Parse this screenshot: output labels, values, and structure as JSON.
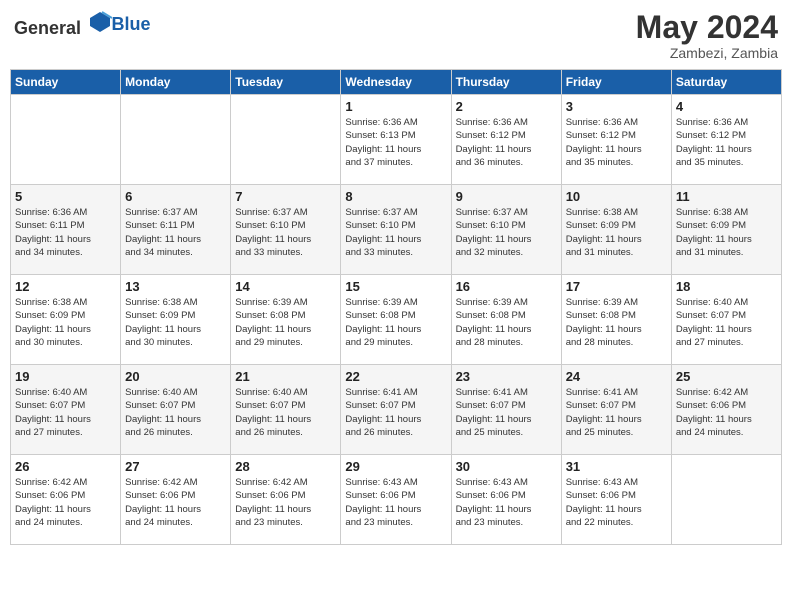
{
  "header": {
    "logo_general": "General",
    "logo_blue": "Blue",
    "month_year": "May 2024",
    "location": "Zambezi, Zambia"
  },
  "calendar": {
    "days_of_week": [
      "Sunday",
      "Monday",
      "Tuesday",
      "Wednesday",
      "Thursday",
      "Friday",
      "Saturday"
    ],
    "weeks": [
      [
        {
          "day": "",
          "info": ""
        },
        {
          "day": "",
          "info": ""
        },
        {
          "day": "",
          "info": ""
        },
        {
          "day": "1",
          "info": "Sunrise: 6:36 AM\nSunset: 6:13 PM\nDaylight: 11 hours\nand 37 minutes."
        },
        {
          "day": "2",
          "info": "Sunrise: 6:36 AM\nSunset: 6:12 PM\nDaylight: 11 hours\nand 36 minutes."
        },
        {
          "day": "3",
          "info": "Sunrise: 6:36 AM\nSunset: 6:12 PM\nDaylight: 11 hours\nand 35 minutes."
        },
        {
          "day": "4",
          "info": "Sunrise: 6:36 AM\nSunset: 6:12 PM\nDaylight: 11 hours\nand 35 minutes."
        }
      ],
      [
        {
          "day": "5",
          "info": "Sunrise: 6:36 AM\nSunset: 6:11 PM\nDaylight: 11 hours\nand 34 minutes."
        },
        {
          "day": "6",
          "info": "Sunrise: 6:37 AM\nSunset: 6:11 PM\nDaylight: 11 hours\nand 34 minutes."
        },
        {
          "day": "7",
          "info": "Sunrise: 6:37 AM\nSunset: 6:10 PM\nDaylight: 11 hours\nand 33 minutes."
        },
        {
          "day": "8",
          "info": "Sunrise: 6:37 AM\nSunset: 6:10 PM\nDaylight: 11 hours\nand 33 minutes."
        },
        {
          "day": "9",
          "info": "Sunrise: 6:37 AM\nSunset: 6:10 PM\nDaylight: 11 hours\nand 32 minutes."
        },
        {
          "day": "10",
          "info": "Sunrise: 6:38 AM\nSunset: 6:09 PM\nDaylight: 11 hours\nand 31 minutes."
        },
        {
          "day": "11",
          "info": "Sunrise: 6:38 AM\nSunset: 6:09 PM\nDaylight: 11 hours\nand 31 minutes."
        }
      ],
      [
        {
          "day": "12",
          "info": "Sunrise: 6:38 AM\nSunset: 6:09 PM\nDaylight: 11 hours\nand 30 minutes."
        },
        {
          "day": "13",
          "info": "Sunrise: 6:38 AM\nSunset: 6:09 PM\nDaylight: 11 hours\nand 30 minutes."
        },
        {
          "day": "14",
          "info": "Sunrise: 6:39 AM\nSunset: 6:08 PM\nDaylight: 11 hours\nand 29 minutes."
        },
        {
          "day": "15",
          "info": "Sunrise: 6:39 AM\nSunset: 6:08 PM\nDaylight: 11 hours\nand 29 minutes."
        },
        {
          "day": "16",
          "info": "Sunrise: 6:39 AM\nSunset: 6:08 PM\nDaylight: 11 hours\nand 28 minutes."
        },
        {
          "day": "17",
          "info": "Sunrise: 6:39 AM\nSunset: 6:08 PM\nDaylight: 11 hours\nand 28 minutes."
        },
        {
          "day": "18",
          "info": "Sunrise: 6:40 AM\nSunset: 6:07 PM\nDaylight: 11 hours\nand 27 minutes."
        }
      ],
      [
        {
          "day": "19",
          "info": "Sunrise: 6:40 AM\nSunset: 6:07 PM\nDaylight: 11 hours\nand 27 minutes."
        },
        {
          "day": "20",
          "info": "Sunrise: 6:40 AM\nSunset: 6:07 PM\nDaylight: 11 hours\nand 26 minutes."
        },
        {
          "day": "21",
          "info": "Sunrise: 6:40 AM\nSunset: 6:07 PM\nDaylight: 11 hours\nand 26 minutes."
        },
        {
          "day": "22",
          "info": "Sunrise: 6:41 AM\nSunset: 6:07 PM\nDaylight: 11 hours\nand 26 minutes."
        },
        {
          "day": "23",
          "info": "Sunrise: 6:41 AM\nSunset: 6:07 PM\nDaylight: 11 hours\nand 25 minutes."
        },
        {
          "day": "24",
          "info": "Sunrise: 6:41 AM\nSunset: 6:07 PM\nDaylight: 11 hours\nand 25 minutes."
        },
        {
          "day": "25",
          "info": "Sunrise: 6:42 AM\nSunset: 6:06 PM\nDaylight: 11 hours\nand 24 minutes."
        }
      ],
      [
        {
          "day": "26",
          "info": "Sunrise: 6:42 AM\nSunset: 6:06 PM\nDaylight: 11 hours\nand 24 minutes."
        },
        {
          "day": "27",
          "info": "Sunrise: 6:42 AM\nSunset: 6:06 PM\nDaylight: 11 hours\nand 24 minutes."
        },
        {
          "day": "28",
          "info": "Sunrise: 6:42 AM\nSunset: 6:06 PM\nDaylight: 11 hours\nand 23 minutes."
        },
        {
          "day": "29",
          "info": "Sunrise: 6:43 AM\nSunset: 6:06 PM\nDaylight: 11 hours\nand 23 minutes."
        },
        {
          "day": "30",
          "info": "Sunrise: 6:43 AM\nSunset: 6:06 PM\nDaylight: 11 hours\nand 23 minutes."
        },
        {
          "day": "31",
          "info": "Sunrise: 6:43 AM\nSunset: 6:06 PM\nDaylight: 11 hours\nand 22 minutes."
        },
        {
          "day": "",
          "info": ""
        }
      ]
    ]
  }
}
